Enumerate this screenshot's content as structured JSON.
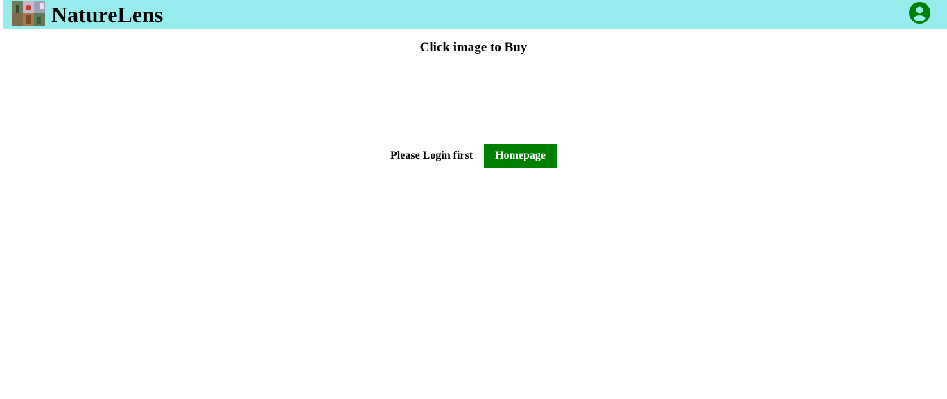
{
  "header": {
    "brand": "NatureLens",
    "logo_icon": "collage-photo-logo",
    "profile_icon": "user-circle-icon",
    "colors": {
      "bar": "#96ecec",
      "accent": "#008000"
    }
  },
  "main": {
    "headline": "Click image to Buy",
    "login_message": "Please Login first",
    "homepage_button": "Homepage"
  }
}
